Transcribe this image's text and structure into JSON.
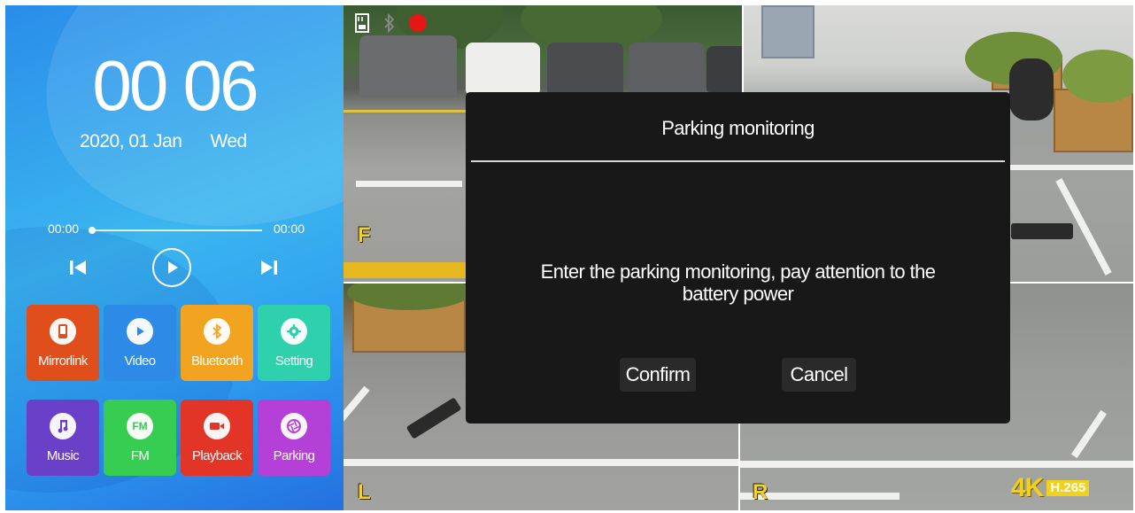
{
  "clock": {
    "time": "00 06",
    "date": "2020, 01 Jan",
    "weekday": "Wed"
  },
  "player": {
    "elapsed": "00:00",
    "duration": "00:00",
    "progress": 0
  },
  "apps": [
    {
      "label": "Mirrorlink",
      "color": "#e04e1b",
      "icon": "phone-icon"
    },
    {
      "label": "Video",
      "color": "#2d8ae6",
      "icon": "play-icon"
    },
    {
      "label": "Bluetooth",
      "color": "#f2a31f",
      "icon": "bluetooth-icon"
    },
    {
      "label": "Setting",
      "color": "#2fd1ad",
      "icon": "gear-icon"
    },
    {
      "label": "Music",
      "color": "#6a40c9",
      "icon": "music-note-icon"
    },
    {
      "label": "FM",
      "color": "#37cd52",
      "icon": "fm-icon",
      "icon_text": "FM"
    },
    {
      "label": "Playback",
      "color": "#e23528",
      "icon": "camera-icon"
    },
    {
      "label": "Parking",
      "color": "#b440d8",
      "icon": "aperture-icon"
    }
  ],
  "cameras": {
    "front": "F",
    "left": "L",
    "rear": "R"
  },
  "badge": {
    "resolution": "4K",
    "codec": "H.265"
  },
  "dialog": {
    "title": "Parking monitoring",
    "message": "Enter the parking monitoring, pay attention to the battery power",
    "confirm": "Confirm",
    "cancel": "Cancel"
  }
}
